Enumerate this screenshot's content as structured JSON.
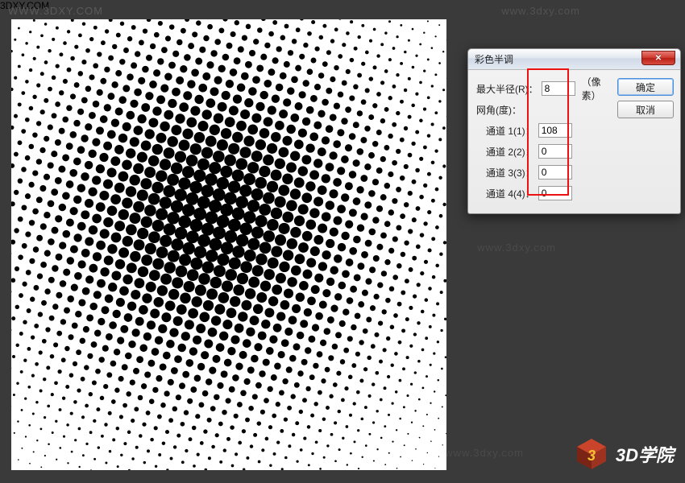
{
  "watermarks": {
    "tl": "WWW.3DXY.COM",
    "tr": "www.3dxy.com",
    "mid": "www.3dxy.com",
    "bl": "www.3dxy.com",
    "br": "www.3dxy.com"
  },
  "dialog": {
    "title": "彩色半调",
    "max_radius_label": "最大半径(R)：",
    "max_radius_value": "8",
    "max_radius_suffix": "（像素）",
    "angle_heading": "网角(度)：",
    "channels": [
      {
        "label": "通道 1(1)：",
        "value": "108"
      },
      {
        "label": "通道 2(2)：",
        "value": "0"
      },
      {
        "label": "通道 3(3)：",
        "value": "0"
      },
      {
        "label": "通道 4(4)：",
        "value": "0"
      }
    ],
    "ok_label": "确定",
    "cancel_label": "取消",
    "close_glyph": "✕"
  },
  "logo": {
    "text": "3D学院",
    "sub": "3DXY.COM"
  },
  "chart_data": {
    "type": "halftone",
    "description": "Radial halftone dot pattern on white canvas",
    "grid_angle_deg": 108,
    "max_dot_radius_px": 8,
    "center": [
      0.46,
      0.44
    ],
    "falloff": "gaussian"
  }
}
